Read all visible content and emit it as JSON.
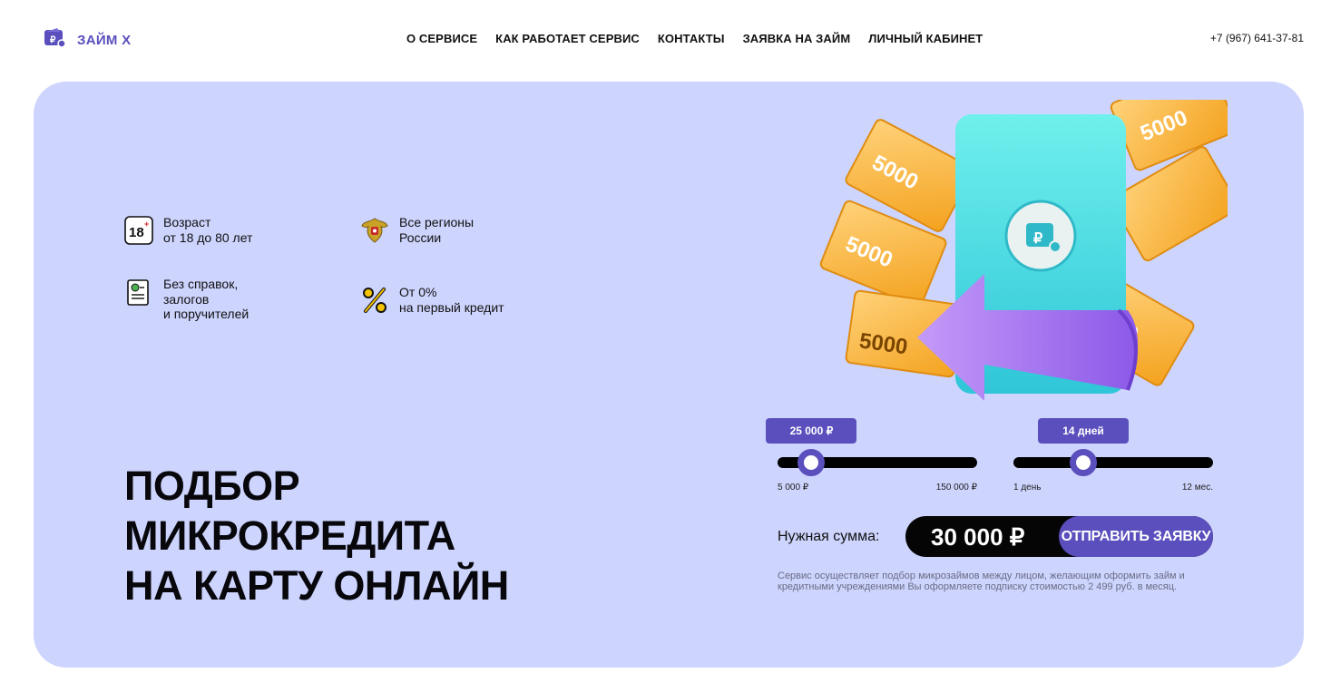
{
  "brand": {
    "name": "ЗАЙМ Х",
    "accent_color": "#5a4fbd",
    "hero_bg": "#cdd4fd"
  },
  "nav": {
    "items": [
      {
        "label": "О СЕРВИСЕ"
      },
      {
        "label": "КАК РАБОТАЕТ СЕРВИС"
      },
      {
        "label": "КОНТАКТЫ"
      },
      {
        "label": "ЗАЯВКА НА ЗАЙМ"
      },
      {
        "label": "ЛИЧНЫЙ КАБИНЕТ"
      }
    ]
  },
  "phone": "+7 (967) 641-37-81",
  "features": [
    {
      "icon": "age-18-icon",
      "text": "Возраст\nот 18 до 80 лет"
    },
    {
      "icon": "coat-of-arms-icon",
      "text": "Все регионы\nРоссии"
    },
    {
      "icon": "document-icon",
      "text": "Без справок,\nзалогов\nи поручителей"
    },
    {
      "icon": "percent-icon",
      "text": "От 0%\nна первый кредит"
    }
  ],
  "headline": {
    "line1": "ПОДБОР",
    "line2": "МИКРОКРЕДИТА",
    "line3": "НА КАРТУ ОНЛАЙН"
  },
  "illustration": {
    "banknote_label": "5000"
  },
  "amount_slider": {
    "value_label": "25 000 ₽",
    "min_label": "5 000 ₽",
    "max_label": "150 000 ₽",
    "position": 0.17
  },
  "term_slider": {
    "value_label": "14 дней",
    "min_label": "1 день",
    "max_label": "12 мес.",
    "position": 0.35
  },
  "summary": {
    "label": "Нужная сумма:",
    "value": "30 000 ₽",
    "submit_label": "ОТПРАВИТЬ ЗАЯВКУ"
  },
  "disclaimer": "Сервис осуществляет подбор микрозаймов между лицом, желающим оформить займ и кредитными учреждениями Вы оформляете подписку стоимостью 2 499 руб. в месяц."
}
